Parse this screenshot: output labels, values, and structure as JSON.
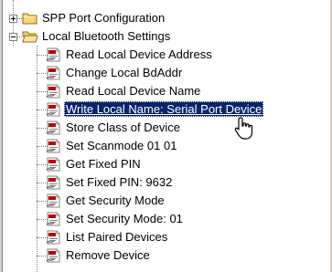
{
  "tree": {
    "folders": [
      {
        "label": "SPP Port Configuration",
        "expander": "+",
        "icon": "folder-closed-icon"
      },
      {
        "label": "Local Bluetooth Settings",
        "expander": "-",
        "icon": "folder-open-icon"
      }
    ],
    "items": [
      {
        "label": "Read Local Device Address",
        "icon": "script-page-icon"
      },
      {
        "label": "Change Local BdAddr",
        "icon": "script-page-icon"
      },
      {
        "label": "Read Local Device Name",
        "icon": "script-page-icon"
      },
      {
        "label": "Write Local Name: Serial Port Device",
        "icon": "script-page-icon",
        "selected": true
      },
      {
        "label": "Store Class of Device",
        "icon": "script-page-icon"
      },
      {
        "label": "Set Scanmode 01 01",
        "icon": "script-page-icon"
      },
      {
        "label": "Get Fixed PIN",
        "icon": "script-page-icon"
      },
      {
        "label": "Set Fixed PIN: 9632",
        "icon": "script-page-icon"
      },
      {
        "label": "Get Security Mode",
        "icon": "script-page-icon"
      },
      {
        "label": "Set Security Mode: 01",
        "icon": "script-page-icon"
      },
      {
        "label": "List Paired Devices",
        "icon": "script-page-icon"
      },
      {
        "label": "Remove Device",
        "icon": "script-page-icon"
      }
    ]
  },
  "colors": {
    "selection": "#0a246a",
    "folder": "#f7d774",
    "folder_border": "#8a6d1a",
    "icon_text": "#c00000"
  },
  "cursor": {
    "icon": "hand-pointer-icon"
  }
}
